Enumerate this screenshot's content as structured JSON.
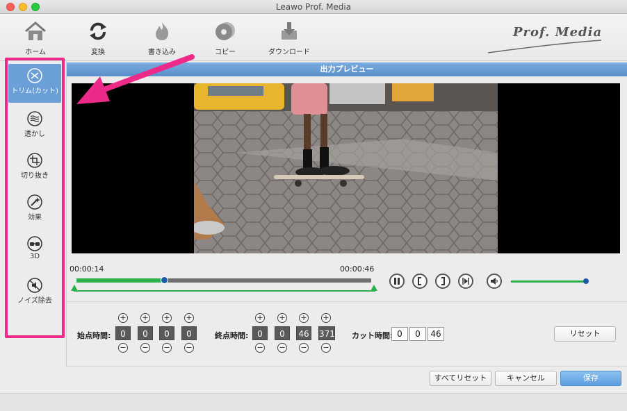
{
  "window": {
    "title": "Leawo Prof. Media"
  },
  "toolbar": {
    "items": [
      {
        "label": "ホーム",
        "icon": "home-icon"
      },
      {
        "label": "変換",
        "icon": "convert-icon"
      },
      {
        "label": "書き込み",
        "icon": "burn-icon"
      },
      {
        "label": "コピー",
        "icon": "copy-disc-icon"
      },
      {
        "label": "ダウンロード",
        "icon": "download-icon"
      }
    ],
    "brand": "Prof. Media"
  },
  "sidebar": {
    "items": [
      {
        "label": "トリム(カット)",
        "icon": "trim-icon",
        "active": true
      },
      {
        "label": "透かし",
        "icon": "watermark-icon"
      },
      {
        "label": "切り抜き",
        "icon": "crop-icon"
      },
      {
        "label": "効果",
        "icon": "effect-icon"
      },
      {
        "label": "3D",
        "icon": "3d-glasses-icon"
      },
      {
        "label": "ノイズ除去",
        "icon": "noise-removal-icon"
      }
    ]
  },
  "preview": {
    "header": "出力プレビュー"
  },
  "timeline": {
    "current_time": "00:00:14",
    "end_time": "00:00:46",
    "progress": 0.3
  },
  "playback": {
    "pause_icon": "pause-icon",
    "mark_in_icon": "mark-in-icon",
    "mark_out_icon": "mark-out-icon",
    "next_frame_icon": "next-frame-icon",
    "volume_icon": "volume-icon",
    "volume_level": 1.0
  },
  "start_time": {
    "label": "始点時間:",
    "fields": [
      "0",
      "0",
      "0",
      "0"
    ]
  },
  "end_time_edit": {
    "label": "終点時間:",
    "fields": [
      "0",
      "0",
      "46",
      "371"
    ]
  },
  "cut_time": {
    "label": "カット時間:",
    "fields": [
      "0",
      "0",
      "46"
    ]
  },
  "buttons": {
    "reset": "リセット",
    "reset_all": "すべてリセット",
    "cancel": "キャンセル",
    "save": "保存"
  },
  "colors": {
    "accent": "#5a8fcc",
    "highlight": "#ee2a88",
    "progress": "#2bb04c"
  }
}
